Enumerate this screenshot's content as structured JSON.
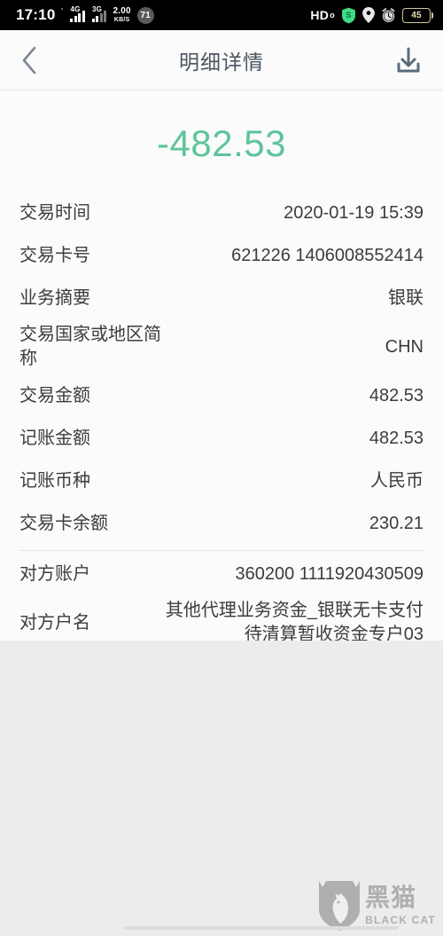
{
  "statusbar": {
    "time": "17:10",
    "network_1": "4G",
    "network_2": "3G",
    "net_speed_value": "2.00",
    "net_speed_unit": "KB/S",
    "notification_count": "71",
    "hd_label": "HD",
    "hd_sub": "o",
    "battery_level": "45",
    "icons": [
      "signal-4g-icon",
      "signal-3g-icon",
      "network-speed-icon",
      "notification-count-badge",
      "hd-icon",
      "shield-icon",
      "location-pin-icon",
      "alarm-clock-icon",
      "battery-icon"
    ]
  },
  "header": {
    "title": "明细详情",
    "back_icon": "chevron-left-icon",
    "download_icon": "download-icon"
  },
  "amount": {
    "value": "-482.53",
    "color": "#5ec49a"
  },
  "details": {
    "group_1": [
      {
        "label": "交易时间",
        "value": "2020-01-19 15:39"
      },
      {
        "label": "交易卡号",
        "value": "621226 1406008552414"
      },
      {
        "label": "业务摘要",
        "value": "银联"
      },
      {
        "label": "交易国家或地区简称",
        "value": "CHN"
      },
      {
        "label": "交易金额",
        "value": "482.53"
      },
      {
        "label": "记账金额",
        "value": "482.53"
      },
      {
        "label": "记账币种",
        "value": "人民币"
      },
      {
        "label": "交易卡余额",
        "value": "230.21"
      }
    ],
    "group_2": [
      {
        "label": "对方账户",
        "value": "360200 1111920430509"
      },
      {
        "label": "对方户名",
        "value": "其他代理业务资金_银联无卡支付待清算暂收资金专户03"
      }
    ]
  },
  "watermark": {
    "cn": "黑猫",
    "en": "BLACK CAT",
    "logo_icon": "black-cat-shield-logo-icon"
  }
}
